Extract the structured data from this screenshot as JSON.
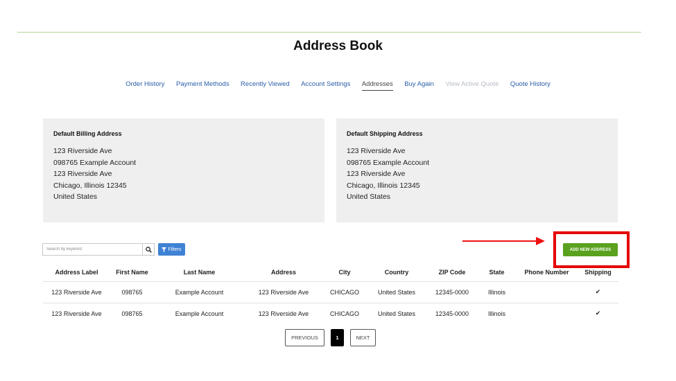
{
  "page": {
    "title": "Address Book"
  },
  "nav": [
    {
      "label": "Order History",
      "state": "normal"
    },
    {
      "label": "Payment Methods",
      "state": "normal"
    },
    {
      "label": "Recently Viewed",
      "state": "normal"
    },
    {
      "label": "Account Settings",
      "state": "normal"
    },
    {
      "label": "Addresses",
      "state": "active"
    },
    {
      "label": "Buy Again",
      "state": "normal"
    },
    {
      "label": "View Active Quote",
      "state": "disabled"
    },
    {
      "label": "Quote History",
      "state": "normal"
    }
  ],
  "billing": {
    "title": "Default Billing Address",
    "lines": [
      "123 Riverside Ave",
      "098765 Example Account",
      "123 Riverside Ave",
      "Chicago, Illinois 12345",
      "United States"
    ]
  },
  "shipping": {
    "title": "Default Shipping Address",
    "lines": [
      "123 Riverside Ave",
      "098765 Example Account",
      "123 Riverside Ave",
      "Chicago, Illinois 12345",
      "United States"
    ]
  },
  "toolbar": {
    "search_placeholder": "Search by keyword",
    "search_icon": "search-icon",
    "filters_label": "Filters",
    "filter_icon": "filter-icon",
    "add_label": "ADD NEW ADDRESS"
  },
  "annotation": {
    "color": "#e60000"
  },
  "table": {
    "columns": [
      "Address Label",
      "First Name",
      "Last Name",
      "Address",
      "City",
      "Country",
      "ZIP Code",
      "State",
      "Phone Number",
      "Shipping"
    ],
    "rows": [
      [
        "123 Riverside Ave",
        "098765",
        "Example Account",
        "123 Riverside Ave",
        "CHICAGO",
        "United States",
        "12345-0000",
        "Illinois",
        "",
        "✔"
      ],
      [
        "123 Riverside Ave",
        "098765",
        "Example Account",
        "123 Riverside Ave",
        "CHICAGO",
        "United States",
        "12345-0000",
        "Illinois",
        "",
        "✔"
      ]
    ]
  },
  "pagination": {
    "prev_label": "PREVIOUS",
    "current_page": "1",
    "next_label": "NEXT"
  },
  "colors": {
    "link": "#2a5ea8",
    "accent_green": "#5aa11e",
    "filters_blue": "#3f82d4",
    "card_bg": "#efefef"
  }
}
